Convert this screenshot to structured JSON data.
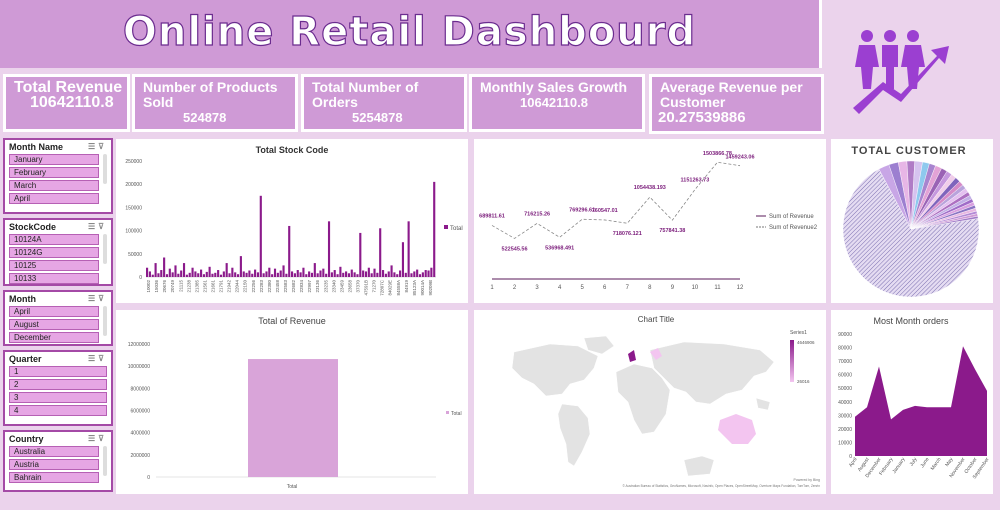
{
  "header": {
    "title": "Online Retail Dashbourd"
  },
  "kpis": [
    {
      "label": "Total Revenue",
      "value": "10642110.8"
    },
    {
      "label": "Number of Products Sold",
      "value": "524878"
    },
    {
      "label": "Total Number of Orders",
      "value": "5254878"
    },
    {
      "label": "Monthly Sales Growth",
      "value": "10642110.8"
    },
    {
      "label": "Average Revenue per Customer",
      "value": "20.27539886"
    }
  ],
  "slicers": [
    {
      "title": "Month Name",
      "items": [
        "January",
        "February",
        "March",
        "April"
      ]
    },
    {
      "title": "StockCode",
      "items": [
        "10124A",
        "10124G",
        "10125",
        "10133"
      ]
    },
    {
      "title": "Month",
      "items": [
        "April",
        "August",
        "December"
      ]
    },
    {
      "title": "Quarter",
      "items": [
        "1",
        "2",
        "3",
        "4"
      ]
    },
    {
      "title": "Country",
      "items": [
        "Australia",
        "Austria",
        "Bahrain"
      ]
    }
  ],
  "colors": {
    "primary": "#8b1a8b",
    "light": "#d9a4d9",
    "kpi_bg": "#cf9ad6",
    "background": "#ebd3ec"
  },
  "icons": {
    "logo": "people-growth-icon",
    "slicer_multi_select": "multi-select-icon",
    "slicer_clear_filter": "clear-filter-icon"
  },
  "chart_data": [
    {
      "type": "bar",
      "title": "Total Stock Code",
      "legend": "Total",
      "legend_position": "right",
      "ylim": [
        0,
        250000
      ],
      "yticks": [
        0,
        50000,
        100000,
        150000,
        200000,
        250000
      ],
      "xtick_labels": [
        "10002",
        "15036",
        "20676",
        "20749",
        "21115",
        "21238",
        "21385",
        "21561",
        "21661",
        "21791",
        "21942",
        "22044",
        "22150",
        "22256",
        "22283",
        "22380",
        "22458",
        "22583",
        "22682",
        "22834",
        "22997",
        "23136",
        "23235",
        "23340",
        "23459",
        "23658",
        "37370",
        "47591B",
        "71270",
        "72807C",
        "84029E",
        "84558A",
        "84919",
        "85123A",
        "90014A",
        "90209B"
      ],
      "values": [
        20000,
        12000,
        5000,
        30000,
        8000,
        15000,
        42000,
        6000,
        18000,
        10000,
        25000,
        7000,
        14000,
        30000,
        5000,
        9000,
        20000,
        12000,
        8000,
        16000,
        6000,
        11000,
        22000,
        7000,
        9000,
        15000,
        5000,
        12000,
        30000,
        8000,
        20000,
        10000,
        6000,
        45000,
        12000,
        9000,
        14000,
        7000,
        16000,
        10000,
        175000,
        8000,
        12000,
        20000,
        6000,
        18000,
        9000,
        14000,
        25000,
        7000,
        110000,
        12000,
        8000,
        15000,
        10000,
        20000,
        6000,
        12000,
        9000,
        30000,
        8000,
        14000,
        18000,
        7000,
        120000,
        10000,
        15000,
        6000,
        22000,
        9000,
        12000,
        8000,
        16000,
        10000,
        6000,
        95000,
        14000,
        12000,
        20000,
        8000,
        18000,
        9000,
        105000,
        15000,
        7000,
        12000,
        25000,
        10000,
        6000,
        14000,
        75000,
        9000,
        120000,
        8000,
        12000,
        16000,
        6000,
        10000,
        15000,
        14000,
        20000,
        205000
      ]
    },
    {
      "type": "line",
      "x": [
        1,
        2,
        3,
        4,
        5,
        6,
        7,
        8,
        9,
        10,
        11,
        12
      ],
      "series": [
        {
          "name": "Sum of Revenue",
          "values": [
            0,
            0,
            0,
            0,
            0,
            0,
            0,
            0,
            0,
            0,
            0,
            0
          ]
        },
        {
          "name": "Sum of Revenue2",
          "values": [
            689811.61,
            522545.56,
            716215.26,
            536968.491,
            769296.61,
            760547.01,
            718076.121,
            1054438.193,
            757841.38,
            1151263.73,
            1503866.78,
            1459243.06
          ]
        }
      ],
      "data_labels": [
        "689811.61",
        "522545.56",
        "716215.26",
        "536968.491",
        "769296.61",
        "760547.01",
        "718076.121",
        "1054438.193",
        "757841.38",
        "1151263.73",
        "1503866.78",
        "1459243.06"
      ],
      "legend_position": "right"
    },
    {
      "type": "pie",
      "title": "TOTAL CUSTOMER",
      "values": [
        68,
        2.5,
        2.2,
        2,
        1.8,
        1.8,
        1.6,
        1.5,
        1.5,
        1.4,
        1.3,
        1.2,
        1.2,
        1.1,
        1,
        1,
        0.9,
        0.9,
        0.8,
        0.8,
        0.7,
        0.7,
        0.6,
        0.6,
        0.5
      ]
    },
    {
      "type": "bar",
      "title": "Total of Revenue",
      "categories": [
        "Total"
      ],
      "values": [
        10642110.8
      ],
      "legend": "Total",
      "legend_position": "right",
      "ylim": [
        0,
        12000000
      ],
      "yticks": [
        0,
        2000000,
        4000000,
        6000000,
        8000000,
        10000000,
        12000000
      ]
    },
    {
      "type": "map",
      "title": "Chart Title",
      "legend_title": "Series1",
      "legend_max": "4646906",
      "legend_min": "26016",
      "attribution_top": "Powered by Bing",
      "attribution": "© Australian Bureau of Statistics, GeoNames, Microsoft, Navinfo, Open Places, OpenStreetMap, Overture Maps Fundation, TomTom, Zenrin"
    },
    {
      "type": "area",
      "title": "Most Month orders",
      "categories": [
        "April",
        "August",
        "December",
        "February",
        "January",
        "July",
        "June",
        "March",
        "May",
        "November",
        "October",
        "September"
      ],
      "values": [
        29000,
        36000,
        66000,
        27000,
        34000,
        37000,
        36000,
        36000,
        36000,
        81000,
        64000,
        48000
      ],
      "ylim": [
        0,
        90000
      ],
      "yticks": [
        0,
        10000,
        20000,
        30000,
        40000,
        50000,
        60000,
        70000,
        80000,
        90000
      ]
    }
  ]
}
